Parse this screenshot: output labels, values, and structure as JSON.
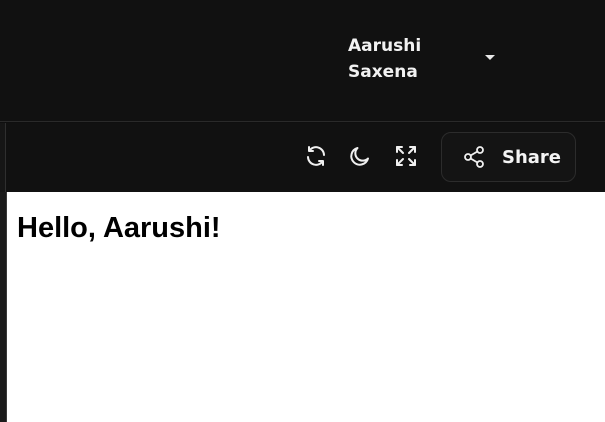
{
  "header": {
    "user_name": "Aarushi Saxena"
  },
  "toolbar": {
    "icons": [
      "refresh-icon",
      "moon-icon",
      "fullscreen-icon"
    ],
    "share_label": "Share"
  },
  "content": {
    "greeting": "Hello, Aarushi!"
  },
  "colors": {
    "background": "#111111",
    "content_background": "#ffffff",
    "text": "#ffffff"
  }
}
